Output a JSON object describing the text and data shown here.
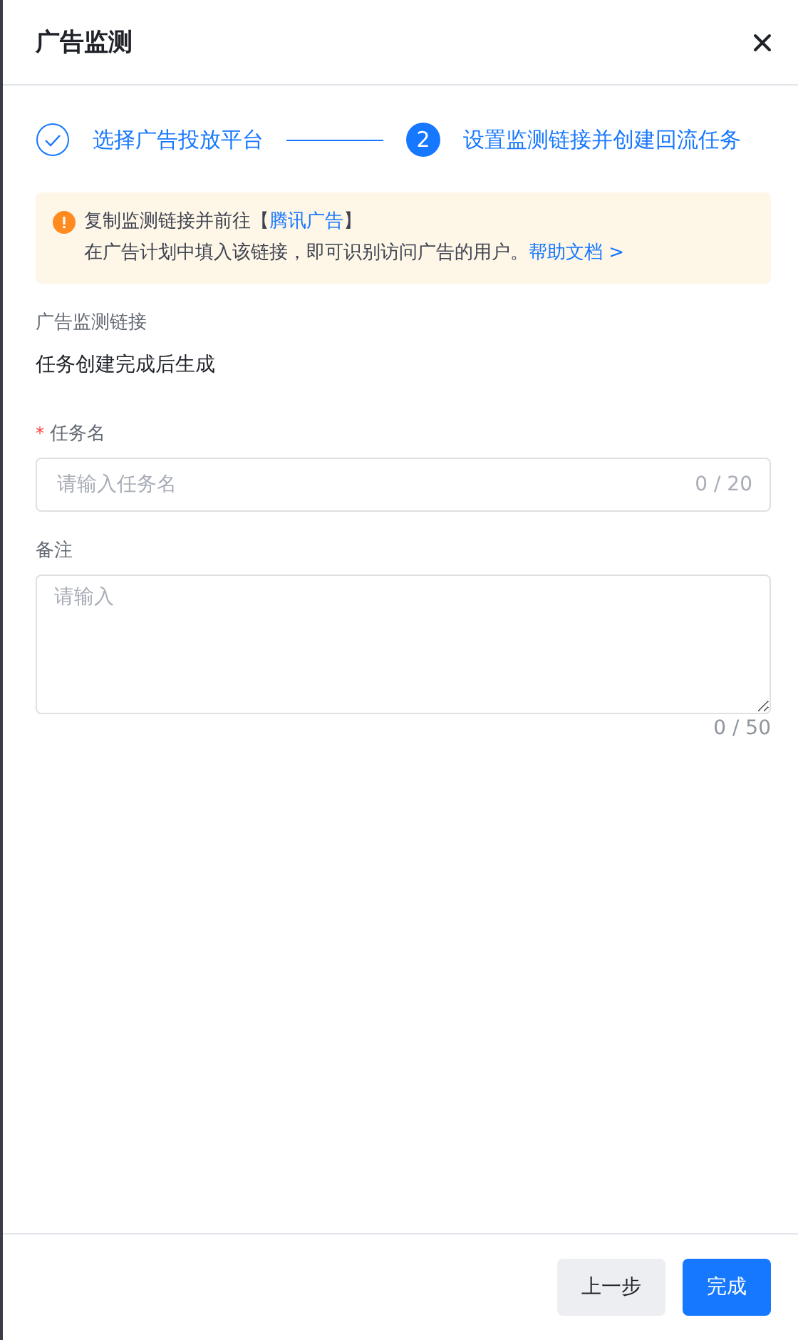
{
  "window": {
    "title": "广告监测"
  },
  "steps": [
    {
      "kind": "done",
      "label": "选择广告投放平台"
    },
    {
      "kind": "current",
      "number": "2",
      "label": "设置监测链接并创建回流任务"
    }
  ],
  "alert": {
    "lines": [
      {
        "before": "复制监测链接并前往【",
        "link": "腾讯广告",
        "after": "】"
      },
      {
        "before": "在广告计划中填入该链接，即可识别访问广告的用户。",
        "link": "帮助文档 >"
      }
    ]
  },
  "link_field": {
    "label": "广告监测链接",
    "value": "任务创建完成后生成"
  },
  "task_name": {
    "label": "任务名",
    "required_mark": "*",
    "placeholder": "请输入任务名",
    "counter": "0 / 20"
  },
  "remark": {
    "label": "备注",
    "placeholder": "请输入",
    "counter": "0 / 50"
  },
  "buttons": [
    {
      "kind": "secondary",
      "label": "上一步"
    },
    {
      "kind": "primary",
      "label": "完成"
    }
  ]
}
